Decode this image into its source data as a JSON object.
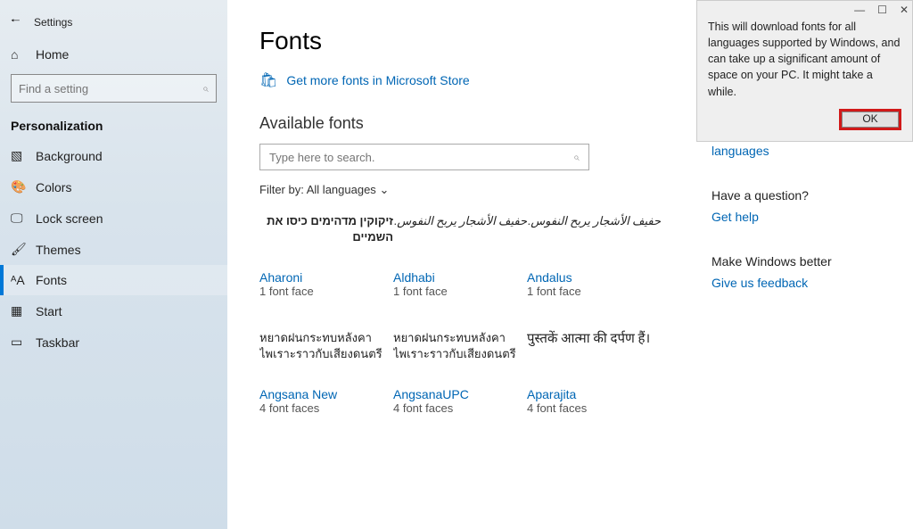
{
  "header": {
    "title": "Settings"
  },
  "sidebar": {
    "home": "Home",
    "search_placeholder": "Find a setting",
    "category": "Personalization",
    "items": [
      {
        "icon": "▧",
        "label": "Background"
      },
      {
        "icon": "🎨",
        "label": "Colors"
      },
      {
        "icon": "🖵",
        "label": "Lock screen"
      },
      {
        "icon": "🖌",
        "label": "Themes"
      },
      {
        "icon": "ᴬA",
        "label": "Fonts"
      },
      {
        "icon": "▦",
        "label": "Start"
      },
      {
        "icon": "▭",
        "label": "Taskbar"
      }
    ],
    "active_index": 4
  },
  "main": {
    "title": "Fonts",
    "store_link": "Get more fonts in Microsoft Store",
    "section_title": "Available fonts",
    "search_placeholder": "Type here to search.",
    "filter_label": "Filter by:",
    "filter_value": "All languages",
    "tiles": [
      {
        "sample": "זיקוקין מדהימים כיסו את השמיים",
        "cls": "rtl",
        "name": "Aharoni",
        "faces": "1 font face"
      },
      {
        "sample": "حفيف الأشجار يربح النفوس.",
        "cls": "arabic",
        "name": "Aldhabi",
        "faces": "1 font face"
      },
      {
        "sample": "حفيف الأشجار يربح النفوس.",
        "cls": "arabic",
        "name": "Andalus",
        "faces": "1 font face"
      },
      {
        "sample": "หยาดฝนกระทบหลังคาไพเราะราวกับเสียงดนตรี",
        "cls": "",
        "name": "Angsana New",
        "faces": "4 font faces"
      },
      {
        "sample": "หยาดฝนกระทบหลังคาไพเราะราวกับเสียงดนตรี",
        "cls": "",
        "name": "AngsanaUPC",
        "faces": "4 font faces"
      },
      {
        "sample": "पुस्तकें आत्मा की दर्पण हैं।",
        "cls": "devan",
        "name": "Aparajita",
        "faces": "4 font faces"
      }
    ]
  },
  "right": {
    "download_link": "Download fonts for all languages",
    "question_hdr": "Have a question?",
    "help_link": "Get help",
    "better_hdr": "Make Windows better",
    "feedback_link": "Give us feedback"
  },
  "dialog": {
    "text": "This will download fonts for all languages supported by Windows, and can take up a significant amount of space on your PC. It might take a while.",
    "ok": "OK"
  }
}
